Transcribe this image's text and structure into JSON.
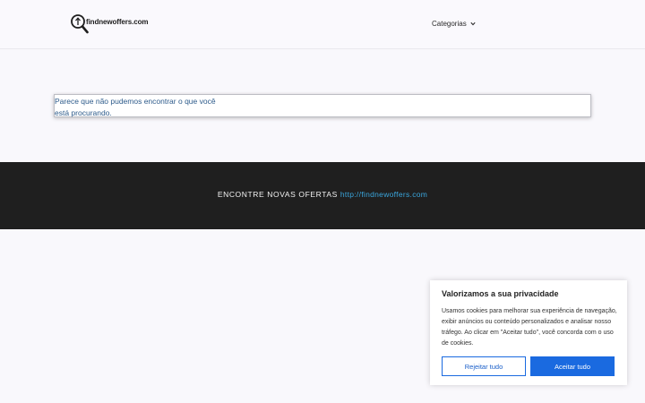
{
  "header": {
    "logo_text": "findnewoffers.com",
    "nav": {
      "label": "Categorias",
      "icon": "chevron-down-icon"
    }
  },
  "main": {
    "notice_text": "Parece que não pudemos encontrar o que você está procurando."
  },
  "band": {
    "text": "ENCONTRE NOVAS OFERTAS",
    "link": "http://findnewoffers.com"
  },
  "cookie_banner": {
    "title": "Valorizamos a sua privacidade",
    "body": "Usamos cookies para melhorar sua experiência de navegação, exibir anúncios ou conteúdo personalizados e analisar nosso tráfego. Ao clicar em \"Aceitar tudo\", você concorda com o uso de cookies.",
    "reject_label": "Rejeitar tudo",
    "accept_label": "Aceitar tudo"
  },
  "colors": {
    "accent": "#1a6ae0",
    "band_background": "#1f1f1f",
    "link": "#3aa6dd",
    "notice_text": "#2c5a8a"
  }
}
